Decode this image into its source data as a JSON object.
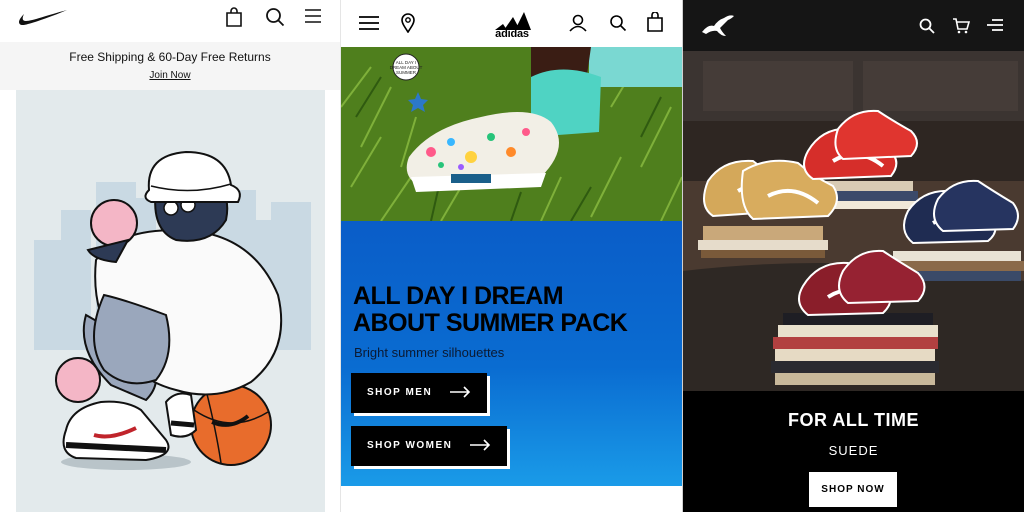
{
  "nike": {
    "promo_text": "Free Shipping & 60-Day Free Returns",
    "promo_link": "Join Now",
    "icons": [
      "swoosh-logo",
      "bag-icon",
      "search-icon",
      "menu-icon"
    ]
  },
  "adidas": {
    "logo_text": "adidas",
    "sticker_text": "ALL DAY I DREAM ABOUT SUMMER",
    "title_line1": "ALL DAY I DREAM",
    "title_line2": "ABOUT SUMMER PACK",
    "subtitle": "Bright summer silhouettes",
    "shop_men": "SHOP MEN",
    "shop_women": "SHOP WOMEN",
    "icons": [
      "menu-icon",
      "location-icon",
      "user-icon",
      "search-icon",
      "bag-icon",
      "arrow-right-icon"
    ],
    "colors": {
      "banner": "#0a5dc8"
    }
  },
  "puma": {
    "title": "FOR ALL TIME",
    "subtitle": "SUEDE",
    "button": "SHOP NOW",
    "icons": [
      "puma-cat-logo",
      "search-icon",
      "cart-icon",
      "menu-icon"
    ]
  }
}
